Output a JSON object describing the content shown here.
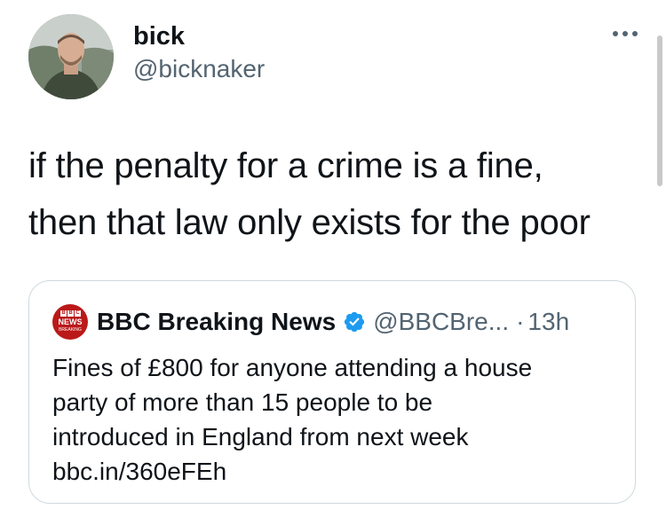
{
  "author": {
    "display_name": "bick",
    "handle": "@bicknaker",
    "avatar_icon": "profile-photo-icon"
  },
  "tweet": {
    "text_lines": [
      "if the penalty for a crime is a fine,",
      "then that law only exists for the poor"
    ]
  },
  "more_icon": "more-options-icon",
  "quote": {
    "account_name": "BBC Breaking News",
    "verified": true,
    "handle": "@BBCBre...",
    "separator": "·",
    "time": "13h",
    "logo": {
      "line1": "BBC",
      "line2": "NEWS",
      "line3": "BREAKING"
    },
    "text_lines": [
      "Fines of £800 for anyone attending a house",
      "party of more than 15 people to be",
      "introduced in England from next week",
      "bbc.in/360eFEh"
    ]
  },
  "colors": {
    "primary_text": "#0f1419",
    "secondary_text": "#536471",
    "border": "#cfd9de",
    "verified_blue": "#1d9bf0",
    "bbc_red": "#bb1919"
  }
}
